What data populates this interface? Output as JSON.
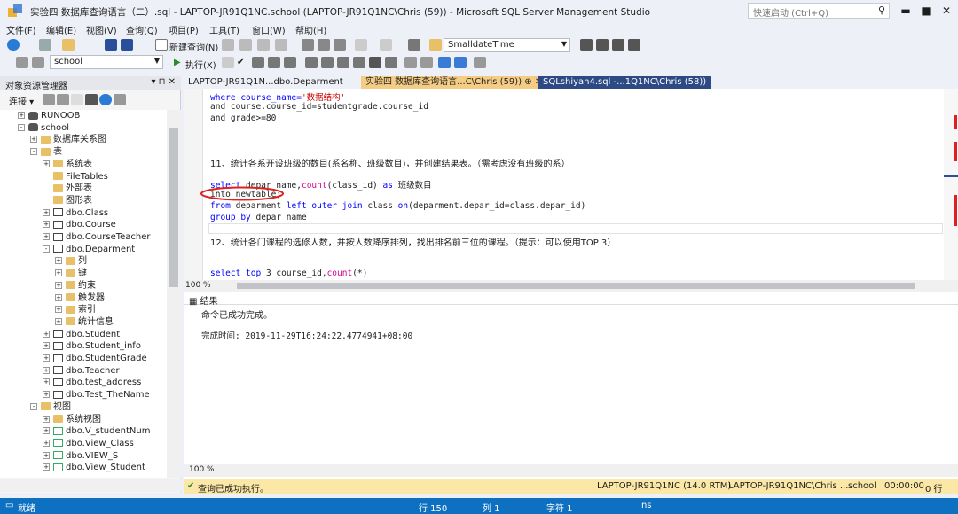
{
  "window": {
    "title": "实验四 数据库查询语言（二）.sql - LAPTOP-JR91Q1NC.school (LAPTOP-JR91Q1NC\\Chris (59)) - Microsoft SQL Server Management Studio",
    "quick_launch_placeholder": "快速启动 (Ctrl+Q)"
  },
  "menu": [
    "文件(F)",
    "编辑(E)",
    "视图(V)",
    "查询(Q)",
    "项目(P)",
    "工具(T)",
    "窗口(W)",
    "帮助(H)"
  ],
  "toolbar": {
    "new_query": "新建查询(N)",
    "datatype_combo": "SmalldateTime",
    "db_combo": "school",
    "execute": "执行(X)"
  },
  "object_explorer": {
    "title": "对象资源管理器",
    "connect": "连接",
    "items": [
      {
        "label": "RUNOOB",
        "level": 1,
        "icon": "db",
        "exp": "+"
      },
      {
        "label": "school",
        "level": 1,
        "icon": "db",
        "exp": "-"
      },
      {
        "label": "数据库关系图",
        "level": 2,
        "icon": "folder",
        "exp": "+"
      },
      {
        "label": "表",
        "level": 2,
        "icon": "folder",
        "exp": "-"
      },
      {
        "label": "系统表",
        "level": 3,
        "icon": "folder",
        "exp": "+"
      },
      {
        "label": "FileTables",
        "level": 3,
        "icon": "folder",
        "exp": ""
      },
      {
        "label": "外部表",
        "level": 3,
        "icon": "folder",
        "exp": ""
      },
      {
        "label": "图形表",
        "level": 3,
        "icon": "folder",
        "exp": ""
      },
      {
        "label": "dbo.Class",
        "level": 3,
        "icon": "tbl",
        "exp": "+"
      },
      {
        "label": "dbo.Course",
        "level": 3,
        "icon": "tbl",
        "exp": "+"
      },
      {
        "label": "dbo.CourseTeacher",
        "level": 3,
        "icon": "tbl",
        "exp": "+"
      },
      {
        "label": "dbo.Deparment",
        "level": 3,
        "icon": "tbl",
        "exp": "-"
      },
      {
        "label": "列",
        "level": 4,
        "icon": "folder",
        "exp": "+"
      },
      {
        "label": "键",
        "level": 4,
        "icon": "folder",
        "exp": "+"
      },
      {
        "label": "约束",
        "level": 4,
        "icon": "folder",
        "exp": "+"
      },
      {
        "label": "触发器",
        "level": 4,
        "icon": "folder",
        "exp": "+"
      },
      {
        "label": "索引",
        "level": 4,
        "icon": "folder",
        "exp": "+"
      },
      {
        "label": "统计信息",
        "level": 4,
        "icon": "folder",
        "exp": "+"
      },
      {
        "label": "dbo.Student",
        "level": 3,
        "icon": "tbl",
        "exp": "+"
      },
      {
        "label": "dbo.Student_info",
        "level": 3,
        "icon": "tbl",
        "exp": "+"
      },
      {
        "label": "dbo.StudentGrade",
        "level": 3,
        "icon": "tbl",
        "exp": "+"
      },
      {
        "label": "dbo.Teacher",
        "level": 3,
        "icon": "tbl",
        "exp": "+"
      },
      {
        "label": "dbo.test_address",
        "level": 3,
        "icon": "tbl",
        "exp": "+"
      },
      {
        "label": "dbo.Test_TheName",
        "level": 3,
        "icon": "tbl",
        "exp": "+"
      },
      {
        "label": "视图",
        "level": 2,
        "icon": "folder",
        "exp": "-"
      },
      {
        "label": "系统视图",
        "level": 3,
        "icon": "folder",
        "exp": "+"
      },
      {
        "label": "dbo.V_studentNum",
        "level": 3,
        "icon": "viewi",
        "exp": "+"
      },
      {
        "label": "dbo.View_Class",
        "level": 3,
        "icon": "viewi",
        "exp": "+"
      },
      {
        "label": "dbo.VIEW_S",
        "level": 3,
        "icon": "viewi",
        "exp": "+"
      },
      {
        "label": "dbo.View_Student",
        "level": 3,
        "icon": "viewi",
        "exp": "+"
      }
    ]
  },
  "tabs": [
    {
      "label": "LAPTOP-JR91Q1N...dbo.Deparment",
      "state": "plain"
    },
    {
      "label": "实验四 数据库查询语言...C\\Chris (59))  ⊕  ✕",
      "state": "active"
    },
    {
      "label": "SQLshiyan4.sql -...1Q1NC\\Chris (58))",
      "state": "inactive"
    }
  ],
  "editor": {
    "line1_a": "where course_name=",
    "line1_b": "'数据结构'",
    "line2": "and course.course_id=studentgrade.course_id",
    "line3": "and grade>=80",
    "q11": "11、统计各系开设班级的数目(系名称、班级数目)，并创建结果表。（需考虑没有班级的系）",
    "s1_kw": "select",
    "s1_rest": " depar_name,",
    "s1_fn": "count",
    "s1_args": "(class_id)",
    "s1_as": " as ",
    "s1_alias": "班级数目",
    "s2": "into newtable;",
    "s3_kw": "from",
    "s3_a": " deparment ",
    "s3_join": "left outer join",
    "s3_b": " class ",
    "s3_on": "on",
    "s3_c": "(deparment.depar_id=class.depar_id)",
    "s4_kw": "group by",
    "s4_rest": " depar_name",
    "q12": "12、统计各门课程的选修人数，并按人数降序排列，找出排名前三位的课程。（提示：可以使用TOP 3）",
    "s5_kw": "select",
    "s5_top": " top ",
    "s5_rest": "3 course_id,",
    "s5_fn": "count",
    "s5_args": "(*)",
    "zoom": "100 %"
  },
  "results": {
    "tab": "结果",
    "msg1": "命令已成功完成。",
    "msg2": "完成时间: 2019-11-29T16:24:22.4774941+08:00",
    "zoom": "100 %"
  },
  "query_status": {
    "text": "查询已成功执行。",
    "server": "LAPTOP-JR91Q1NC (14.0 RTM)",
    "user": "LAPTOP-JR91Q1NC\\Chris ...",
    "db": "school",
    "time": "00:00:00",
    "rows": "0 行"
  },
  "statusbar": {
    "ready": "就绪",
    "line": "行 150",
    "col": "列 1",
    "ch": "字符 1",
    "ins": "Ins"
  },
  "colors": {
    "accent": "#0e70c0",
    "active_tab": "#f5cc84",
    "inactive_tab": "#2d4a84",
    "status_yellow": "#fbe8a6"
  }
}
